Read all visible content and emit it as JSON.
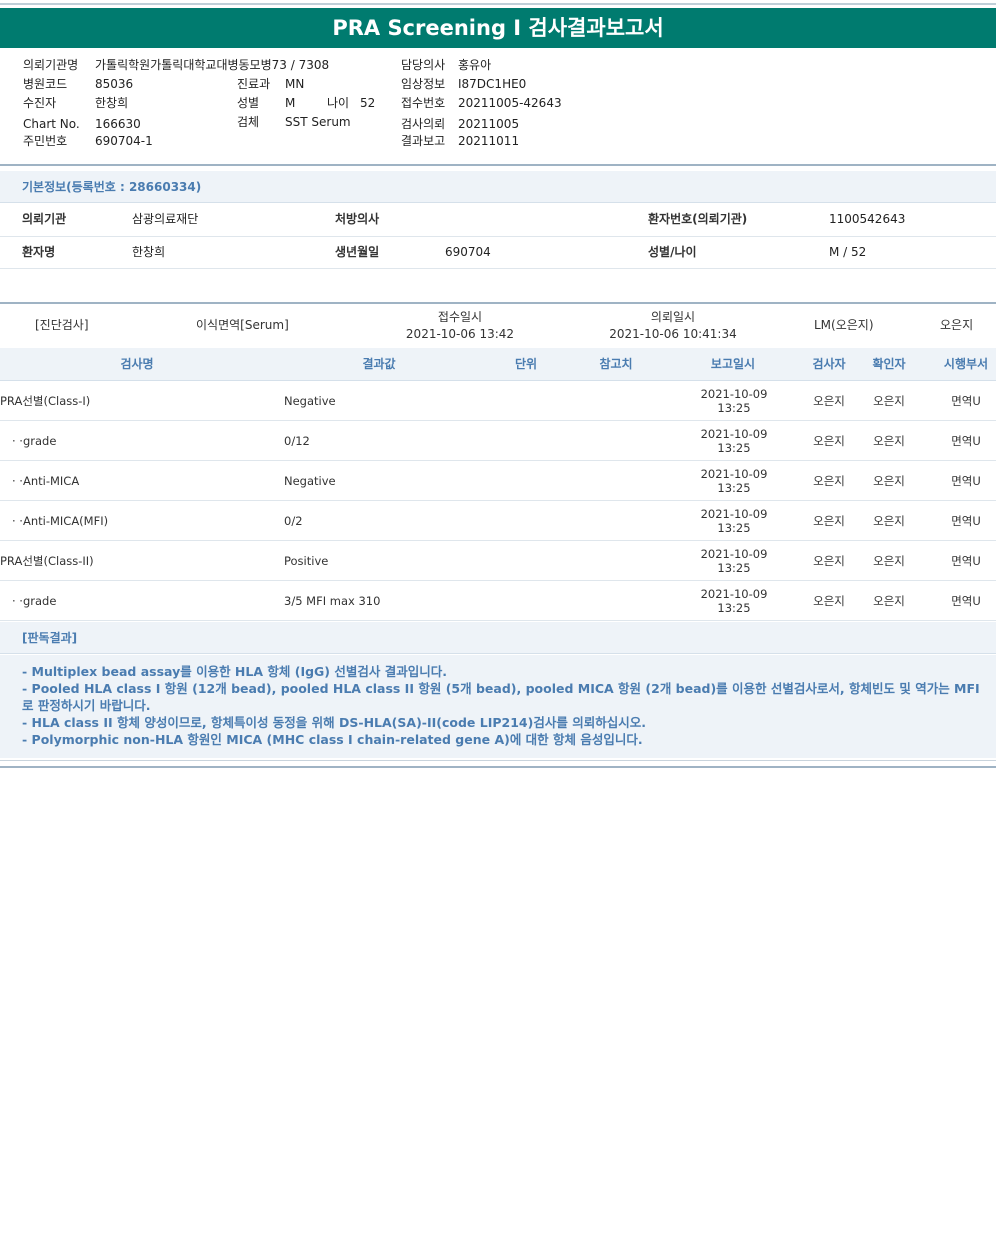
{
  "title": "PRA Screening I 검사결과보고서",
  "header": {
    "institution_label": "의뢰기관명",
    "institution_value": "가톨릭학원가톨릭대학교대병동모병73 / 7308",
    "hospital_code_label": "병원코드",
    "hospital_code_value": "85036",
    "receiver_label": "수진자",
    "receiver_value": "한창희",
    "chart_label": "Chart No.",
    "chart_value": "166630",
    "id_label": "주민번호",
    "id_value": "690704-1",
    "dept_label": "진료과",
    "dept_value": "MN",
    "sex_label": "성별",
    "sex_value": "M",
    "age_label": "나이",
    "age_value": "52",
    "specimen_label": "검체",
    "specimen_value": "SST Serum",
    "doctor_label": "담당의사",
    "doctor_value": "홍유아",
    "clinical_label": "임상정보",
    "clinical_value": "I87DC1HE0",
    "accession_label": "접수번호",
    "accession_value": "20211005-42643",
    "request_label": "검사의뢰",
    "request_value": "20211005",
    "report_label": "결과보고",
    "report_value": "20211011"
  },
  "basic_info": {
    "section_title": "기본정보(등록번호 : 28660334)",
    "rows": [
      {
        "k1": "의뢰기관",
        "v1": "삼광의료재단",
        "k2": "처방의사",
        "v2": "",
        "k3": "환자번호(의뢰기관)",
        "v3": "1100542643"
      },
      {
        "k1": "환자명",
        "v1": "한창희",
        "k2": "생년월일",
        "v2": "690704",
        "k3": "성별/나이",
        "v3": "M / 52"
      }
    ]
  },
  "receipt": {
    "category": "[진단검사]",
    "specimen": "이식면역[Serum]",
    "received_label": "접수일시",
    "received_value": "2021-10-06 13:42",
    "requested_label": "의뢰일시",
    "requested_value": "2021-10-06 10:41:34",
    "reviewer": "LM(오은지)",
    "tester": "오은지"
  },
  "results": {
    "columns": [
      "검사명",
      "결과값",
      "단위",
      "참고치",
      "보고일시",
      "검사자",
      "확인자",
      "시행부서"
    ],
    "rows": [
      {
        "name": "PRA선별(Class-I)",
        "value": "Negative",
        "unit": "",
        "ref": "",
        "date": "2021-10-09",
        "time": "13:25",
        "tester": "오은지",
        "checker": "오은지",
        "dept": "면역U"
      },
      {
        "name": "· ·grade",
        "value": "0/12",
        "unit": "",
        "ref": "",
        "date": "2021-10-09",
        "time": "13:25",
        "tester": "오은지",
        "checker": "오은지",
        "dept": "면역U"
      },
      {
        "name": "· ·Anti-MICA",
        "value": "Negative",
        "unit": "",
        "ref": "",
        "date": "2021-10-09",
        "time": "13:25",
        "tester": "오은지",
        "checker": "오은지",
        "dept": "면역U"
      },
      {
        "name": "· ·Anti-MICA(MFI)",
        "value": "0/2",
        "unit": "",
        "ref": "",
        "date": "2021-10-09",
        "time": "13:25",
        "tester": "오은지",
        "checker": "오은지",
        "dept": "면역U"
      },
      {
        "name": "PRA선별(Class-II)",
        "value": "Positive",
        "unit": "",
        "ref": "",
        "date": "2021-10-09",
        "time": "13:25",
        "tester": "오은지",
        "checker": "오은지",
        "dept": "면역U"
      },
      {
        "name": "· ·grade",
        "value": "3/5 MFI max 310",
        "unit": "",
        "ref": "",
        "date": "2021-10-09",
        "time": "13:25",
        "tester": "오은지",
        "checker": "오은지",
        "dept": "면역U"
      }
    ]
  },
  "opinion": {
    "title": "[판독결과]",
    "lines": [
      "- Multiplex bead assay를 이용한 HLA 항체 (IgG) 선별검사 결과입니다.",
      "- Pooled HLA class I 항원 (12개 bead), pooled HLA class II 항원 (5개 bead), pooled MICA 항원 (2개 bead)를 이용한 선별검사로서, 항체빈도 및 역가는 MFI 로 판정하시기 바랍니다.",
      "- HLA class II 항체 양성이므로, 항체특이성 동정을 위해 DS-HLA(SA)-II(code LIP214)검사를 의뢰하십시오.",
      "- Polymorphic non-HLA 항원인 MICA (MHC class I chain-related gene A)에 대한 항체 음성입니다."
    ]
  }
}
